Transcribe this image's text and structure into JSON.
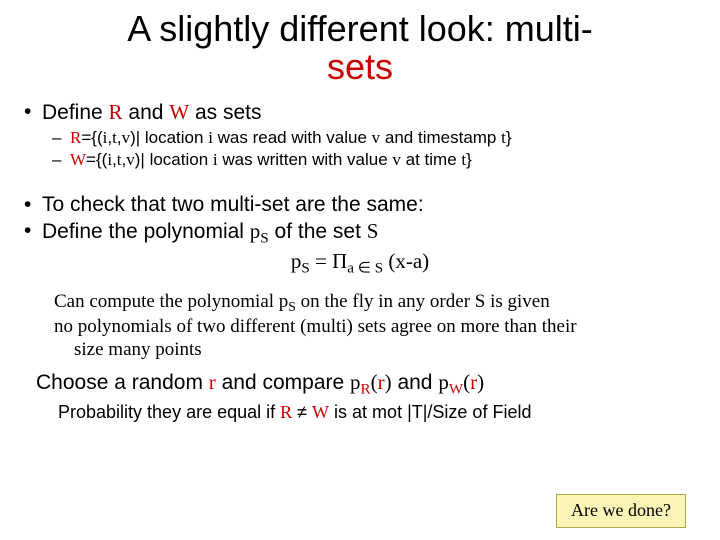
{
  "title_1": "A slightly different look: multi-",
  "title_2": "sets",
  "define_prefix": "Define ",
  "R": "R",
  "W": "W",
  "and_word": " and ",
  "as_sets": " as sets",
  "r_line_1": "={(",
  "r_line_i": "i",
  "r_line_c1": ",",
  "r_line_t": "t",
  "r_line_c2": ",",
  "r_line_v": "v",
  "r_line_2": ")| location ",
  "r_line_3": " was read with value ",
  "r_line_4": " and timestamp ",
  "r_line_end": "}",
  "w_line_mid": " was written with value ",
  "w_line_at": " at time ",
  "check_line": "To check that two multi-set are the same:",
  "define_poly_1": "Define the  polynomial ",
  "p": "p",
  "of_set": " of the set ",
  "S": "S",
  "formula_eq": " = ",
  "prod": "Π",
  "sub_prod": "a ∈ S",
  "rhs": " (x-a)",
  "body_l1": "Can compute the polynomial  p",
  "body_l1b": " on the fly in any order  S is given",
  "body_l2": "no  polynomials of two different (multi) sets agree on more than their",
  "body_l3": "size many points",
  "choose_1": "Choose a random ",
  "r_small": "r",
  "choose_2": " and compare  ",
  "lpar": "(",
  "rpar": ")",
  "sub_R": "R",
  "sub_W": "W",
  "and2": " and  ",
  "prob_1": "Probability they are equal if ",
  "neq": " ≠ ",
  "prob_2": " is at mot |T|/Size of Field",
  "callout": "Are we done?"
}
